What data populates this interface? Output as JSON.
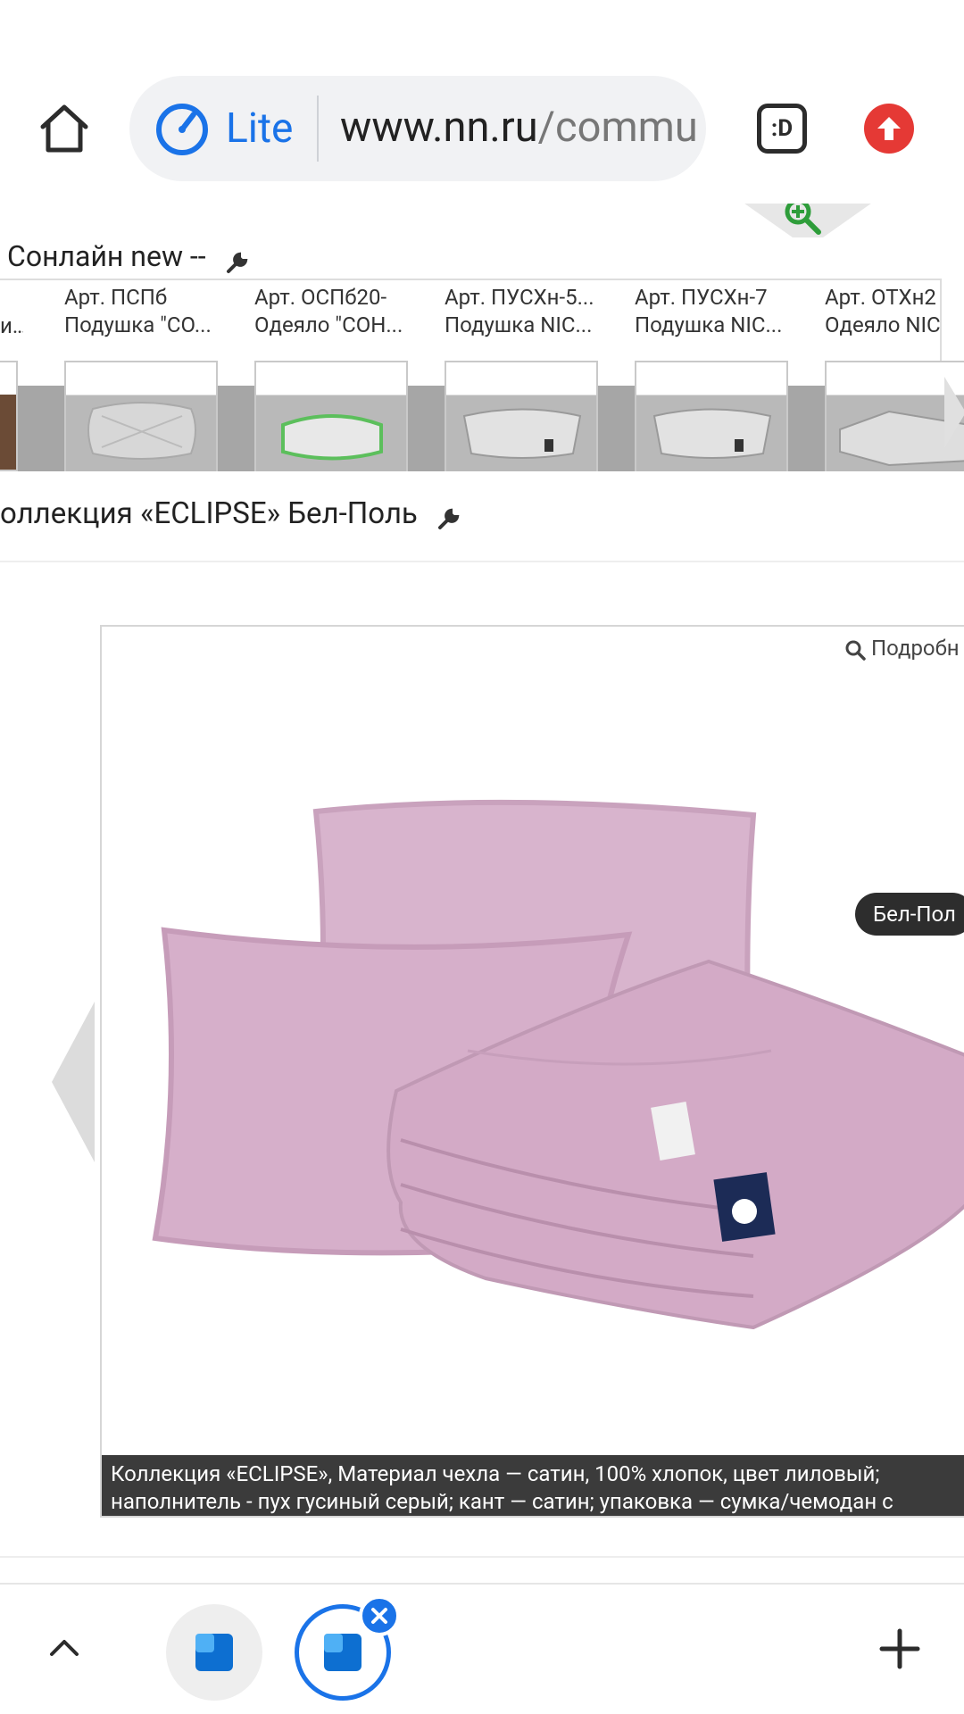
{
  "browser": {
    "mode_label": "Lite",
    "url_main": "www.nn.ru",
    "url_path": "/commu",
    "tabs_icon_text": ":D"
  },
  "section1": {
    "title": "Сонлайн new --"
  },
  "strip": {
    "items": [
      {
        "line1": "Арт. ПСПб",
        "line2": "Подушка \"СО..."
      },
      {
        "line1": "Арт. ОСПб20-",
        "line2": "Одеяло \"СОН..."
      },
      {
        "line1": "Арт. ПУСХн-5...",
        "line2": "Подушка NIC..."
      },
      {
        "line1": "Арт. ПУСХн-7",
        "line2": "Подушка NIC..."
      },
      {
        "line1": "Арт. ОТХн2",
        "line2": "Одеяло NIC"
      }
    ],
    "left_partial": "и..."
  },
  "section2": {
    "title": "оллекция «ECLIPSE» Бел-Поль"
  },
  "gallery": {
    "details_label": "Подробн",
    "brand_tag": "Бел-Пол",
    "caption": "Коллекция «ECLIPSE», Материал чехла — сатин, 100% хлопок, цвет лиловый; наполнитель - пух гусиный серый; кант — сатин; упаковка — сумка/чемодан с"
  },
  "colors": {
    "accent": "#1a73e8",
    "upgrade": "#e53935",
    "product": "#d9b3cc"
  }
}
